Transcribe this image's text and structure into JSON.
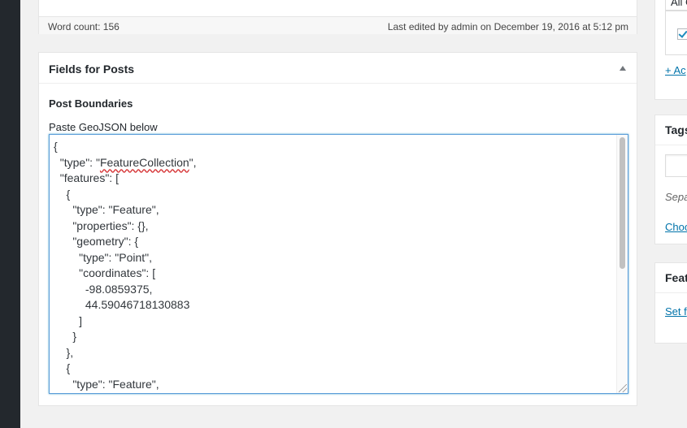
{
  "editor_footer": {
    "word_count": "Word count: 156",
    "last_edited": "Last edited by admin on December 19, 2016 at 5:12 pm"
  },
  "fields_box": {
    "title": "Fields for Posts",
    "field_label": "Post Boundaries",
    "instructions": "Paste GeoJSON below",
    "geojson_lines": [
      "{",
      "  \"type\": \"FeatureCollection\",",
      "  \"features\": [",
      "    {",
      "      \"type\": \"Feature\",",
      "      \"properties\": {},",
      "      \"geometry\": {",
      "        \"type\": \"Point\",",
      "        \"coordinates\": [",
      "          -98.0859375,",
      "          44.59046718130883",
      "        ]",
      "      }",
      "    },",
      "    {",
      "      \"type\": \"Feature\","
    ]
  },
  "sidebar": {
    "categories_tab": "All C",
    "add_category": "+ Ac",
    "tags_title": "Tags",
    "tags_hint": "Sepa",
    "tags_link": "Choo",
    "featured_title": "Feat",
    "featured_link": "Set f"
  },
  "colors": {
    "admin_bar": "#23282d",
    "focus_border": "#5b9dd9",
    "link": "#0073aa",
    "spellcheck": "#d63638"
  }
}
